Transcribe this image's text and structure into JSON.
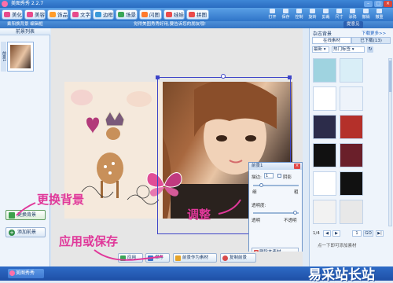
{
  "titlebar": {
    "title": "美图秀秀 2.2.7"
  },
  "toolbar": {
    "tabs": [
      "美化",
      "美容",
      "饰品",
      "文字",
      "边框",
      "场景",
      "闪图",
      "娃娃",
      "拼图"
    ],
    "tab_colors": [
      "#e84a8c",
      "#e84a8c",
      "#ff9c2a",
      "#e84a8c",
      "#3a9ad9",
      "#3aa657",
      "#ff7a2a",
      "#ea4b4b",
      "#ea4b4b"
    ],
    "right_tools": [
      "打开",
      "保存",
      "控制",
      "旋转",
      "剪裁",
      "尺寸",
      "涂鸦",
      "撤销",
      "撤重"
    ]
  },
  "subbar": {
    "left": "乘阳换背景 编辑框",
    "center": "觉得美图秀秀好用,要告诉您的朋友哦!",
    "right_badge": "提意见"
  },
  "leftpanel": {
    "header": "前景列表",
    "side_label": "前景1",
    "change_bg": "更换背景",
    "add_fg": "添加前景"
  },
  "canvas": {
    "colors": {
      "selection": "#3e45c8",
      "bg": "#f5e9dc"
    }
  },
  "adjust_dialog": {
    "title": "前景1",
    "stroke_label": "描边:",
    "stroke_value": "1",
    "shadow_label": "阴影",
    "thin": "细",
    "thick": "粗",
    "opacity_label": "透明度:",
    "transparent": "透明",
    "opaque": "不透明",
    "delete_btn": "删除本素材"
  },
  "rightpanel": {
    "title": "杂志背景",
    "download_more": "下载更多>>",
    "tab_online": "在线素材",
    "tab_downloaded": "已下载(13)",
    "filter_new": "最新",
    "filter_hot": "热门标签",
    "page_info": "1/4",
    "page_input": "1",
    "go": "GO",
    "hint": "点一下即可添加素材"
  },
  "bottombar": {
    "apply": "应用",
    "save": "保存",
    "save_as_material": "前景作为素材",
    "copy": "复制前景"
  },
  "annotations": {
    "change_bg": "更换背景",
    "adjust": "调整",
    "apply_or_save": "应用或保存"
  },
  "taskbar": {
    "app": "美图秀秀"
  },
  "watermark": "易采站长站"
}
